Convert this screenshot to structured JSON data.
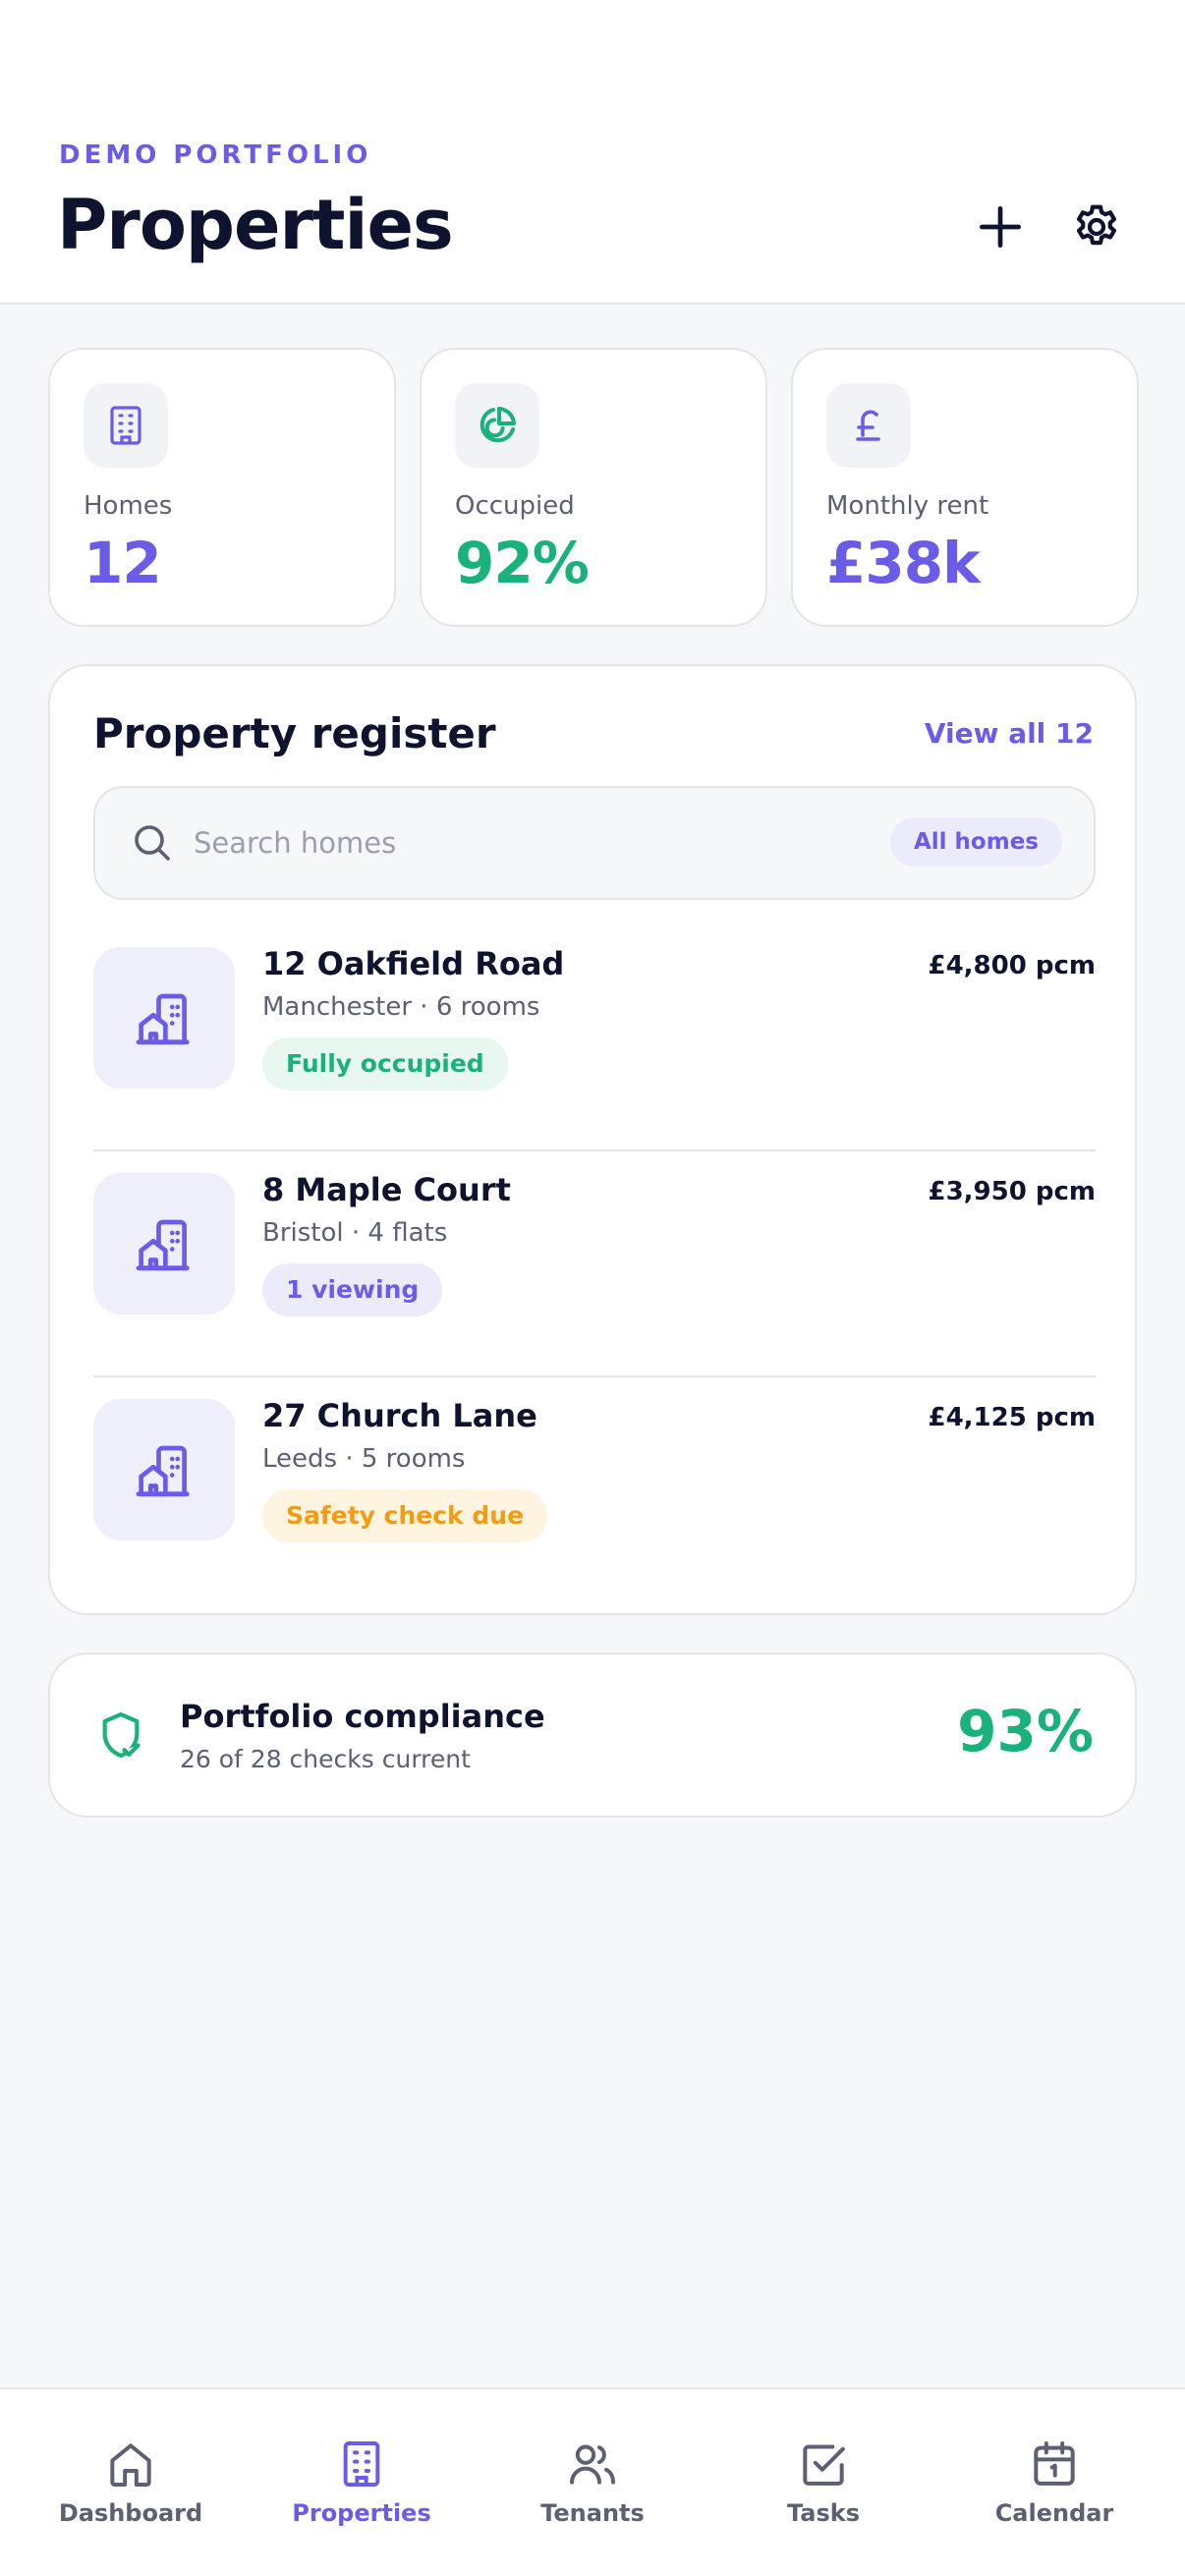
{
  "colors": {
    "accent": "#6b5ce7",
    "positive": "#19b27a",
    "warning": "#f39c12",
    "ink": "#0e1330"
  },
  "header": {
    "eyebrow": "DEMO PORTFOLIO",
    "title": "Properties",
    "actions": [
      {
        "icon": "plus-icon"
      },
      {
        "icon": "gear-icon"
      }
    ]
  },
  "stats": [
    {
      "icon": "building-icon",
      "label": "Homes",
      "value": "12"
    },
    {
      "icon": "pie-chart-icon",
      "label": "Occupied",
      "value": "92%"
    },
    {
      "icon": "pound-icon",
      "label": "Monthly rent",
      "value": "£38k"
    }
  ],
  "register": {
    "title": "Property register",
    "view_all": "View all 12",
    "search": {
      "placeholder": "Search homes",
      "value": "",
      "filter": "All homes"
    },
    "properties": [
      {
        "name": "12 Oakfield Road",
        "meta": "Manchester · 6 rooms",
        "price": "£4,800 pcm",
        "badge": "Fully occupied",
        "status": "positive"
      },
      {
        "name": "8 Maple Court",
        "meta": "Bristol · 4 flats",
        "price": "£3,950 pcm",
        "badge": "1 viewing",
        "status": "info"
      },
      {
        "name": "27 Church Lane",
        "meta": "Leeds · 5 rooms",
        "price": "£4,125 pcm",
        "badge": "Safety check due",
        "status": "warning"
      }
    ]
  },
  "compliance": {
    "icon": "shield-check-icon",
    "title": "Portfolio compliance",
    "subtitle": "26 of 28 checks current",
    "value": "93%"
  },
  "tabs": [
    {
      "icon": "home-icon",
      "label": "Dashboard",
      "active": false
    },
    {
      "icon": "building-icon",
      "label": "Properties",
      "active": true
    },
    {
      "icon": "users-icon",
      "label": "Tenants",
      "active": false
    },
    {
      "icon": "checkbox-icon",
      "label": "Tasks",
      "active": false
    },
    {
      "icon": "calendar-icon",
      "label": "Calendar",
      "active": false
    }
  ]
}
